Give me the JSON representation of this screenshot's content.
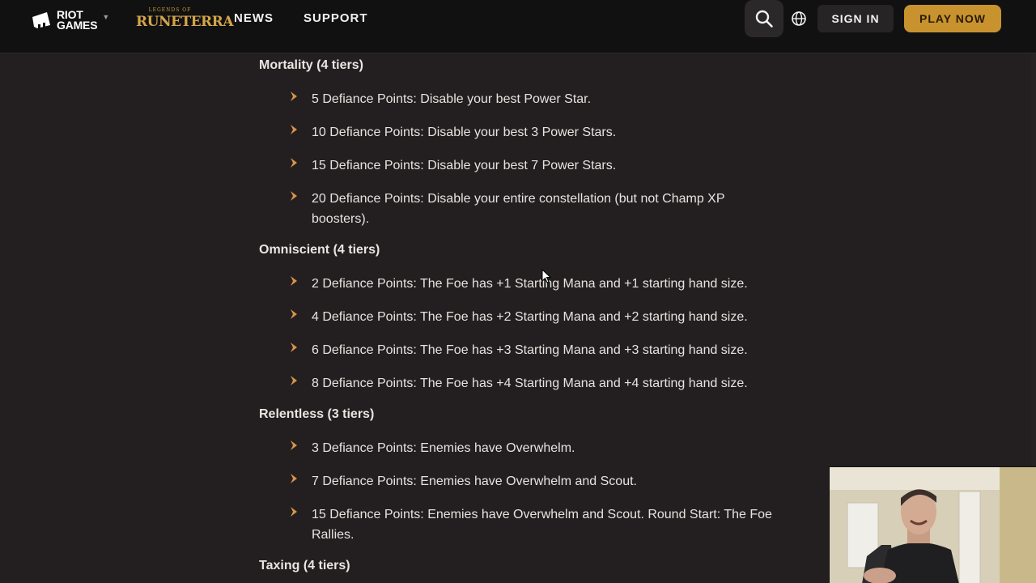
{
  "nav": {
    "riot_line1": "RIOT",
    "riot_line2": "GAMES",
    "lor_small": "LEGENDS OF",
    "lor_big": "RUNETERRA",
    "news": "NEWS",
    "support": "SUPPORT",
    "sign_in": "SIGN IN",
    "play_now": "PLAY NOW"
  },
  "sections": [
    {
      "heading": "Mortality (4 tiers)",
      "items": [
        "5 Defiance Points: Disable your best Power Star.",
        "10 Defiance Points: Disable your best 3 Power Stars.",
        "15 Defiance Points: Disable your best 7 Power Stars.",
        "20 Defiance Points: Disable your entire constellation (but not Champ XP boosters)."
      ]
    },
    {
      "heading": "Omniscient (4 tiers)",
      "items": [
        "2 Defiance Points: The Foe has +1 Starting Mana and +1 starting hand size.",
        "4 Defiance Points: The Foe has +2 Starting Mana and +2 starting hand size.",
        "6 Defiance Points: The Foe has +3 Starting Mana and +3 starting hand size.",
        "8 Defiance Points: The Foe has +4 Starting Mana and +4 starting hand size."
      ]
    },
    {
      "heading": "Relentless (3 tiers)",
      "items": [
        "3 Defiance Points: Enemies have Overwhelm.",
        "7 Defiance Points: Enemies have Overwhelm and Scout.",
        "15 Defiance Points: Enemies have Overwhelm and Scout. Round Start: The Foe Rallies."
      ]
    },
    {
      "heading": "Taxing (4 tiers)",
      "items": []
    }
  ],
  "colors": {
    "background": "#231f20",
    "nav_background": "#121112",
    "accent_gold": "#c8932f",
    "bullet_chevron": "#d9944a"
  },
  "icons": {
    "search": "search-icon",
    "globe": "globe-icon",
    "bullet": "chevron-right-icon"
  }
}
